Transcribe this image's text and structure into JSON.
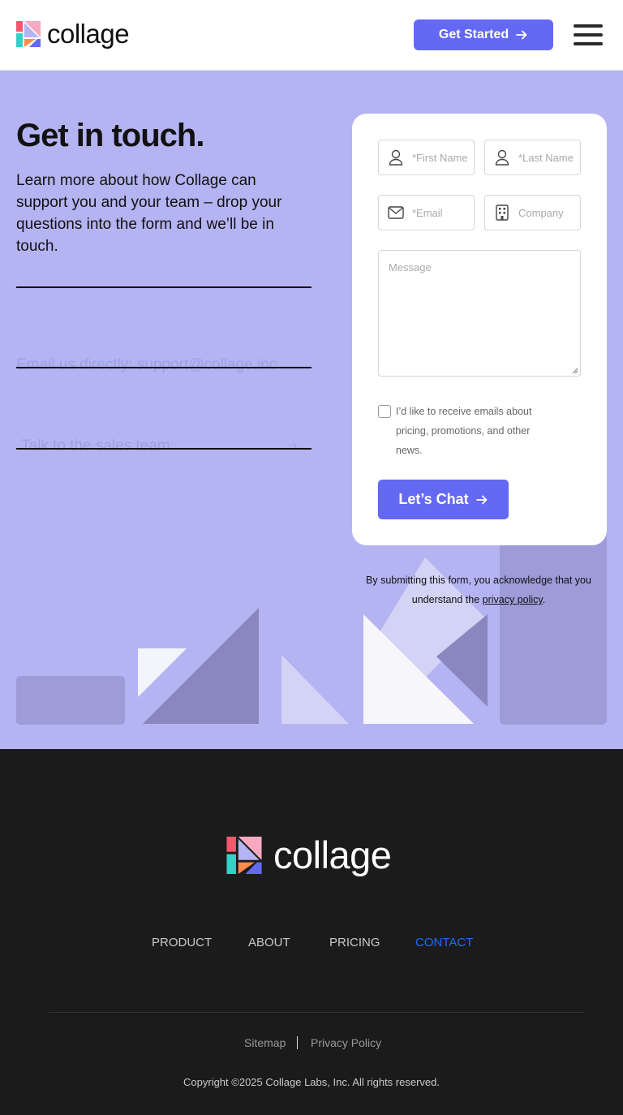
{
  "header": {
    "logo_text": "collage",
    "cta_label": "Get Started",
    "menu_icon": "hamburger-icon"
  },
  "contact": {
    "title": "Get in touch.",
    "intro": "Learn more about how Collage can support you and your team – drop your questions into the form and we’ll be in touch.",
    "email_line": "Email us directly: support@collage.inc",
    "sales_line": "Talk to the sales team"
  },
  "form": {
    "first_name_placeholder": "*First Name",
    "last_name_placeholder": "*Last Name",
    "email_placeholder": "*Email",
    "company_placeholder": "Company",
    "message_placeholder": "Message",
    "consent_text": "I’d like to receive emails about pricing, promotions, and other news.",
    "consent_checked": false,
    "submit_label": "Let’s Chat"
  },
  "acknowledgement": {
    "text_before": "By submitting this form, you acknowledge that you understand the ",
    "link_text": "privacy policy",
    "text_after": "."
  },
  "footer": {
    "logo_text": "collage",
    "nav": [
      "PRODUCT",
      "ABOUT",
      "PRICING",
      "CONTACT"
    ],
    "active_nav": "CONTACT",
    "links": [
      "Sitemap",
      "Privacy Policy"
    ],
    "copyright": "Copyright ©2025 Collage Labs, Inc. All rights reserved."
  },
  "colors": {
    "accent": "#6469f4",
    "section_bg": "#b4b4f2",
    "footer_bg": "#1b1b1b",
    "active_link": "#1e6bff"
  }
}
